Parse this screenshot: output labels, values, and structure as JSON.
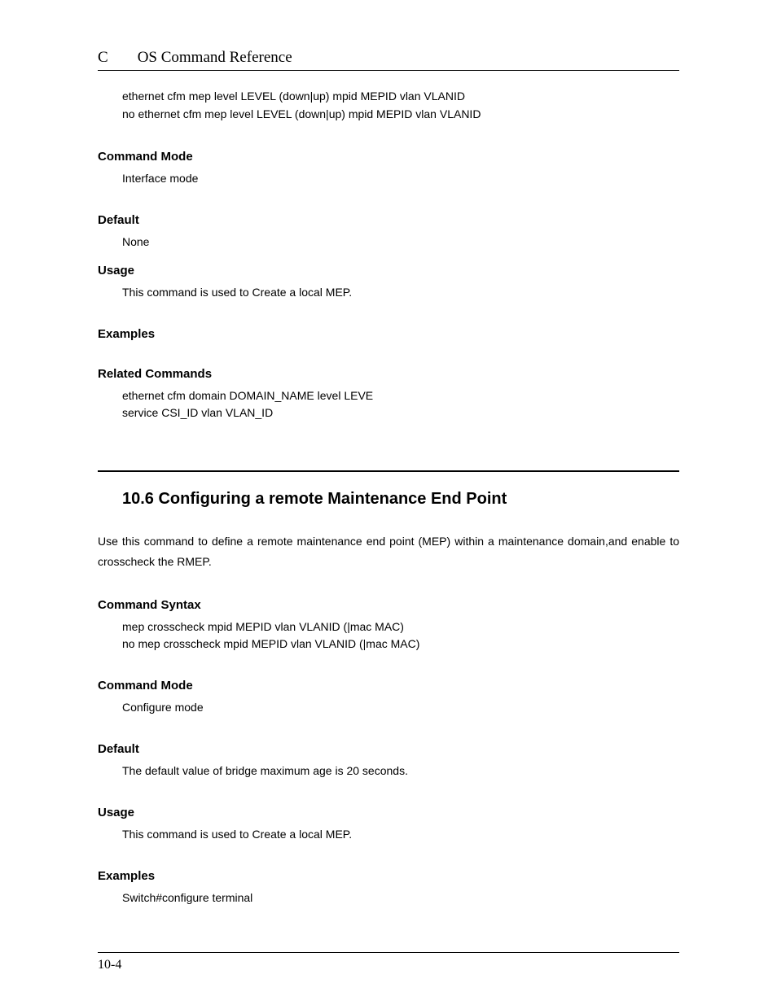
{
  "header": {
    "letter": "C",
    "title": "OS Command Reference"
  },
  "section1": {
    "code_lines": [
      "ethernet cfm mep level LEVEL (down|up) mpid MEPID vlan VLANID",
      "no ethernet cfm mep level LEVEL (down|up) mpid MEPID vlan VLANID"
    ],
    "command_mode_heading": "Command Mode",
    "command_mode_text": "Interface mode",
    "default_heading": "Default",
    "default_text": "None",
    "usage_heading": "Usage",
    "usage_text": "This command is used to Create a local MEP.",
    "examples_heading": "Examples",
    "related_heading": "Related Commands",
    "related_lines": [
      "ethernet cfm domain DOMAIN_NAME level LEVE",
      "service CSI_ID vlan VLAN_ID"
    ]
  },
  "section2": {
    "heading": "10.6 Configuring a remote Maintenance End Point",
    "intro": "Use this command to define a remote maintenance end point (MEP) within a maintenance domain,and enable to crosscheck the RMEP.",
    "syntax_heading": "Command Syntax",
    "syntax_lines": [
      "mep crosscheck mpid MEPID vlan VLANID (|mac MAC)",
      "no mep crosscheck mpid MEPID vlan VLANID (|mac MAC)"
    ],
    "command_mode_heading": "Command Mode",
    "command_mode_text": "Configure mode",
    "default_heading": "Default",
    "default_text": "The default value of bridge maximum age is 20 seconds.",
    "usage_heading": "Usage",
    "usage_text": "This command is used to Create a local MEP.",
    "examples_heading": "Examples",
    "examples_text": "Switch#configure terminal"
  },
  "footer": {
    "page_number": "10-4"
  }
}
